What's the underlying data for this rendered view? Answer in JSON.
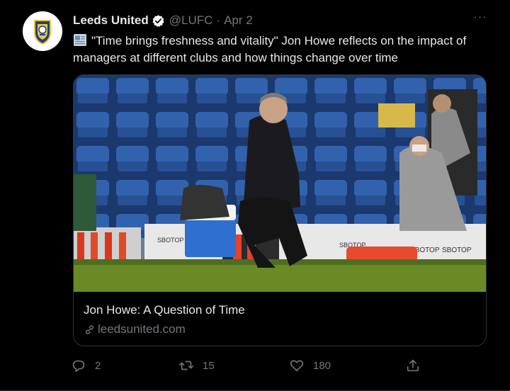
{
  "tweet": {
    "display_name": "Leeds United",
    "handle": "@LUFC",
    "separator": "·",
    "date": "Apr 2",
    "more": "···",
    "text": "\"Time brings freshness and vitality\" Jon Howe reflects on the impact of managers at different clubs and how things change over time"
  },
  "card": {
    "title": "Jon Howe: A Question of Time",
    "domain": "leedsunited.com",
    "image_banner_1": "SBOTOP",
    "image_banner_2": "SBOTOP",
    "image_banner_3": "SBOTOP",
    "image_banner_4": "SBOTOP"
  },
  "actions": {
    "replies": "2",
    "retweets": "15",
    "likes": "180"
  },
  "colors": {
    "background": "#000000",
    "primary_text": "#e7e9ea",
    "secondary_text": "#71767b",
    "verified": "#1d9bf0",
    "border": "#2f3336"
  },
  "icons": [
    "leeds-crest-icon",
    "verified-badge-icon",
    "more-icon",
    "newspaper-icon",
    "link-icon",
    "reply-icon",
    "retweet-icon",
    "like-icon",
    "share-icon"
  ]
}
